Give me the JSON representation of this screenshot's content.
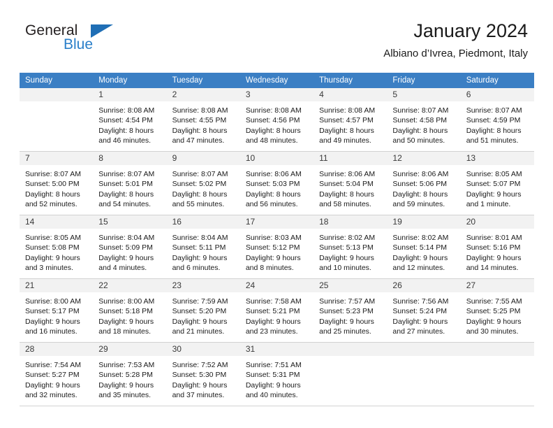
{
  "brand": {
    "name_part1": "General",
    "name_part2": "Blue",
    "triangle_color": "#1f6eb5",
    "blue_color": "#2a7fc9"
  },
  "header": {
    "title": "January 2024",
    "subtitle": "Albiano d’Ivrea, Piedmont, Italy"
  },
  "theme": {
    "header_bg": "#3b7fc4",
    "daynum_bg": "#f2f2f2",
    "grid_line": "#d2d2d2"
  },
  "weekday_headers": [
    "Sunday",
    "Monday",
    "Tuesday",
    "Wednesday",
    "Thursday",
    "Friday",
    "Saturday"
  ],
  "weeks": [
    [
      {
        "day": "",
        "empty": true,
        "sunrise": "",
        "sunset": "",
        "daylight_line1": "",
        "daylight_line2": ""
      },
      {
        "day": "1",
        "empty": false,
        "sunrise": "Sunrise: 8:08 AM",
        "sunset": "Sunset: 4:54 PM",
        "daylight_line1": "Daylight: 8 hours",
        "daylight_line2": "and 46 minutes."
      },
      {
        "day": "2",
        "empty": false,
        "sunrise": "Sunrise: 8:08 AM",
        "sunset": "Sunset: 4:55 PM",
        "daylight_line1": "Daylight: 8 hours",
        "daylight_line2": "and 47 minutes."
      },
      {
        "day": "3",
        "empty": false,
        "sunrise": "Sunrise: 8:08 AM",
        "sunset": "Sunset: 4:56 PM",
        "daylight_line1": "Daylight: 8 hours",
        "daylight_line2": "and 48 minutes."
      },
      {
        "day": "4",
        "empty": false,
        "sunrise": "Sunrise: 8:08 AM",
        "sunset": "Sunset: 4:57 PM",
        "daylight_line1": "Daylight: 8 hours",
        "daylight_line2": "and 49 minutes."
      },
      {
        "day": "5",
        "empty": false,
        "sunrise": "Sunrise: 8:07 AM",
        "sunset": "Sunset: 4:58 PM",
        "daylight_line1": "Daylight: 8 hours",
        "daylight_line2": "and 50 minutes."
      },
      {
        "day": "6",
        "empty": false,
        "sunrise": "Sunrise: 8:07 AM",
        "sunset": "Sunset: 4:59 PM",
        "daylight_line1": "Daylight: 8 hours",
        "daylight_line2": "and 51 minutes."
      }
    ],
    [
      {
        "day": "7",
        "empty": false,
        "sunrise": "Sunrise: 8:07 AM",
        "sunset": "Sunset: 5:00 PM",
        "daylight_line1": "Daylight: 8 hours",
        "daylight_line2": "and 52 minutes."
      },
      {
        "day": "8",
        "empty": false,
        "sunrise": "Sunrise: 8:07 AM",
        "sunset": "Sunset: 5:01 PM",
        "daylight_line1": "Daylight: 8 hours",
        "daylight_line2": "and 54 minutes."
      },
      {
        "day": "9",
        "empty": false,
        "sunrise": "Sunrise: 8:07 AM",
        "sunset": "Sunset: 5:02 PM",
        "daylight_line1": "Daylight: 8 hours",
        "daylight_line2": "and 55 minutes."
      },
      {
        "day": "10",
        "empty": false,
        "sunrise": "Sunrise: 8:06 AM",
        "sunset": "Sunset: 5:03 PM",
        "daylight_line1": "Daylight: 8 hours",
        "daylight_line2": "and 56 minutes."
      },
      {
        "day": "11",
        "empty": false,
        "sunrise": "Sunrise: 8:06 AM",
        "sunset": "Sunset: 5:04 PM",
        "daylight_line1": "Daylight: 8 hours",
        "daylight_line2": "and 58 minutes."
      },
      {
        "day": "12",
        "empty": false,
        "sunrise": "Sunrise: 8:06 AM",
        "sunset": "Sunset: 5:06 PM",
        "daylight_line1": "Daylight: 8 hours",
        "daylight_line2": "and 59 minutes."
      },
      {
        "day": "13",
        "empty": false,
        "sunrise": "Sunrise: 8:05 AM",
        "sunset": "Sunset: 5:07 PM",
        "daylight_line1": "Daylight: 9 hours",
        "daylight_line2": "and 1 minute."
      }
    ],
    [
      {
        "day": "14",
        "empty": false,
        "sunrise": "Sunrise: 8:05 AM",
        "sunset": "Sunset: 5:08 PM",
        "daylight_line1": "Daylight: 9 hours",
        "daylight_line2": "and 3 minutes."
      },
      {
        "day": "15",
        "empty": false,
        "sunrise": "Sunrise: 8:04 AM",
        "sunset": "Sunset: 5:09 PM",
        "daylight_line1": "Daylight: 9 hours",
        "daylight_line2": "and 4 minutes."
      },
      {
        "day": "16",
        "empty": false,
        "sunrise": "Sunrise: 8:04 AM",
        "sunset": "Sunset: 5:11 PM",
        "daylight_line1": "Daylight: 9 hours",
        "daylight_line2": "and 6 minutes."
      },
      {
        "day": "17",
        "empty": false,
        "sunrise": "Sunrise: 8:03 AM",
        "sunset": "Sunset: 5:12 PM",
        "daylight_line1": "Daylight: 9 hours",
        "daylight_line2": "and 8 minutes."
      },
      {
        "day": "18",
        "empty": false,
        "sunrise": "Sunrise: 8:02 AM",
        "sunset": "Sunset: 5:13 PM",
        "daylight_line1": "Daylight: 9 hours",
        "daylight_line2": "and 10 minutes."
      },
      {
        "day": "19",
        "empty": false,
        "sunrise": "Sunrise: 8:02 AM",
        "sunset": "Sunset: 5:14 PM",
        "daylight_line1": "Daylight: 9 hours",
        "daylight_line2": "and 12 minutes."
      },
      {
        "day": "20",
        "empty": false,
        "sunrise": "Sunrise: 8:01 AM",
        "sunset": "Sunset: 5:16 PM",
        "daylight_line1": "Daylight: 9 hours",
        "daylight_line2": "and 14 minutes."
      }
    ],
    [
      {
        "day": "21",
        "empty": false,
        "sunrise": "Sunrise: 8:00 AM",
        "sunset": "Sunset: 5:17 PM",
        "daylight_line1": "Daylight: 9 hours",
        "daylight_line2": "and 16 minutes."
      },
      {
        "day": "22",
        "empty": false,
        "sunrise": "Sunrise: 8:00 AM",
        "sunset": "Sunset: 5:18 PM",
        "daylight_line1": "Daylight: 9 hours",
        "daylight_line2": "and 18 minutes."
      },
      {
        "day": "23",
        "empty": false,
        "sunrise": "Sunrise: 7:59 AM",
        "sunset": "Sunset: 5:20 PM",
        "daylight_line1": "Daylight: 9 hours",
        "daylight_line2": "and 21 minutes."
      },
      {
        "day": "24",
        "empty": false,
        "sunrise": "Sunrise: 7:58 AM",
        "sunset": "Sunset: 5:21 PM",
        "daylight_line1": "Daylight: 9 hours",
        "daylight_line2": "and 23 minutes."
      },
      {
        "day": "25",
        "empty": false,
        "sunrise": "Sunrise: 7:57 AM",
        "sunset": "Sunset: 5:23 PM",
        "daylight_line1": "Daylight: 9 hours",
        "daylight_line2": "and 25 minutes."
      },
      {
        "day": "26",
        "empty": false,
        "sunrise": "Sunrise: 7:56 AM",
        "sunset": "Sunset: 5:24 PM",
        "daylight_line1": "Daylight: 9 hours",
        "daylight_line2": "and 27 minutes."
      },
      {
        "day": "27",
        "empty": false,
        "sunrise": "Sunrise: 7:55 AM",
        "sunset": "Sunset: 5:25 PM",
        "daylight_line1": "Daylight: 9 hours",
        "daylight_line2": "and 30 minutes."
      }
    ],
    [
      {
        "day": "28",
        "empty": false,
        "sunrise": "Sunrise: 7:54 AM",
        "sunset": "Sunset: 5:27 PM",
        "daylight_line1": "Daylight: 9 hours",
        "daylight_line2": "and 32 minutes."
      },
      {
        "day": "29",
        "empty": false,
        "sunrise": "Sunrise: 7:53 AM",
        "sunset": "Sunset: 5:28 PM",
        "daylight_line1": "Daylight: 9 hours",
        "daylight_line2": "and 35 minutes."
      },
      {
        "day": "30",
        "empty": false,
        "sunrise": "Sunrise: 7:52 AM",
        "sunset": "Sunset: 5:30 PM",
        "daylight_line1": "Daylight: 9 hours",
        "daylight_line2": "and 37 minutes."
      },
      {
        "day": "31",
        "empty": false,
        "sunrise": "Sunrise: 7:51 AM",
        "sunset": "Sunset: 5:31 PM",
        "daylight_line1": "Daylight: 9 hours",
        "daylight_line2": "and 40 minutes."
      },
      {
        "day": "",
        "empty": true,
        "sunrise": "",
        "sunset": "",
        "daylight_line1": "",
        "daylight_line2": ""
      },
      {
        "day": "",
        "empty": true,
        "sunrise": "",
        "sunset": "",
        "daylight_line1": "",
        "daylight_line2": ""
      },
      {
        "day": "",
        "empty": true,
        "sunrise": "",
        "sunset": "",
        "daylight_line1": "",
        "daylight_line2": ""
      }
    ]
  ]
}
